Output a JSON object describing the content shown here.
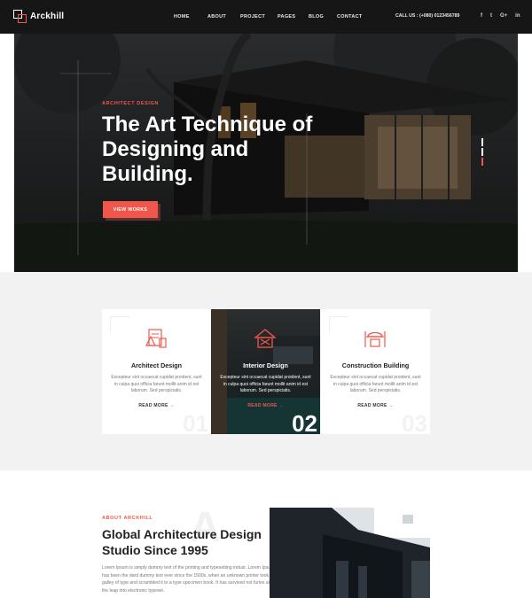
{
  "brand": {
    "name": "Arckhill",
    "accent": "#f0574c"
  },
  "nav": {
    "items": [
      "HOME",
      "ABOUT",
      "PROJECT",
      "PAGES",
      "BLOG",
      "CONTACT"
    ],
    "call": "CALL US : (+080) 0123456789",
    "socials": [
      {
        "icon": "facebook-icon",
        "glyph": "f"
      },
      {
        "icon": "twitter-icon",
        "glyph": "t"
      },
      {
        "icon": "google-plus-icon",
        "glyph": "G+"
      },
      {
        "icon": "linkedin-icon",
        "glyph": "in"
      }
    ]
  },
  "hero": {
    "label": "ARCHITECT DESIGN",
    "title": "The Art Technique of Designing and Building.",
    "button": "VIEW WORKS",
    "slide_count": 3,
    "active_slide": 3
  },
  "services": [
    {
      "title": "Architect Design",
      "icon": "architect-design-icon",
      "desc": "Excepteur sint occaecat cupidat proident, sunt in culpa quoi officia farunt mollit anim id est laborum. Sed perspiciatis.",
      "link": "READ MORE",
      "number": "01"
    },
    {
      "title": "Interior Design",
      "icon": "interior-design-icon",
      "desc": "Excepteur sint occaecat cupidat proident, sunt in culpa quoi officia farunt mollit anim id est laborum. Sed perspiciatis.",
      "link": "READ MORE",
      "number": "02"
    },
    {
      "title": "Construction Building",
      "icon": "construction-building-icon",
      "desc": "Excepteur sint occaecat cupidat proident, sunt in culpa quoi officia farunt mollit anim id est laborum. Sed perspiciatis.",
      "link": "READ MORE",
      "number": "03"
    }
  ],
  "about": {
    "label": "ABOUT ARCKHILL",
    "watermark": "A",
    "title": "Global Architecture Design Studio Since 1995",
    "text": "Lorem Ipsum is simply dummy text of the printing and typesetting indust. Lorem Ipsum has been the dard dummy text ever since the 1500s, when an unknown printer took a galley of type and scrambled it to a type specimen book. It has survived not furies also the leap into electronic typeset."
  }
}
